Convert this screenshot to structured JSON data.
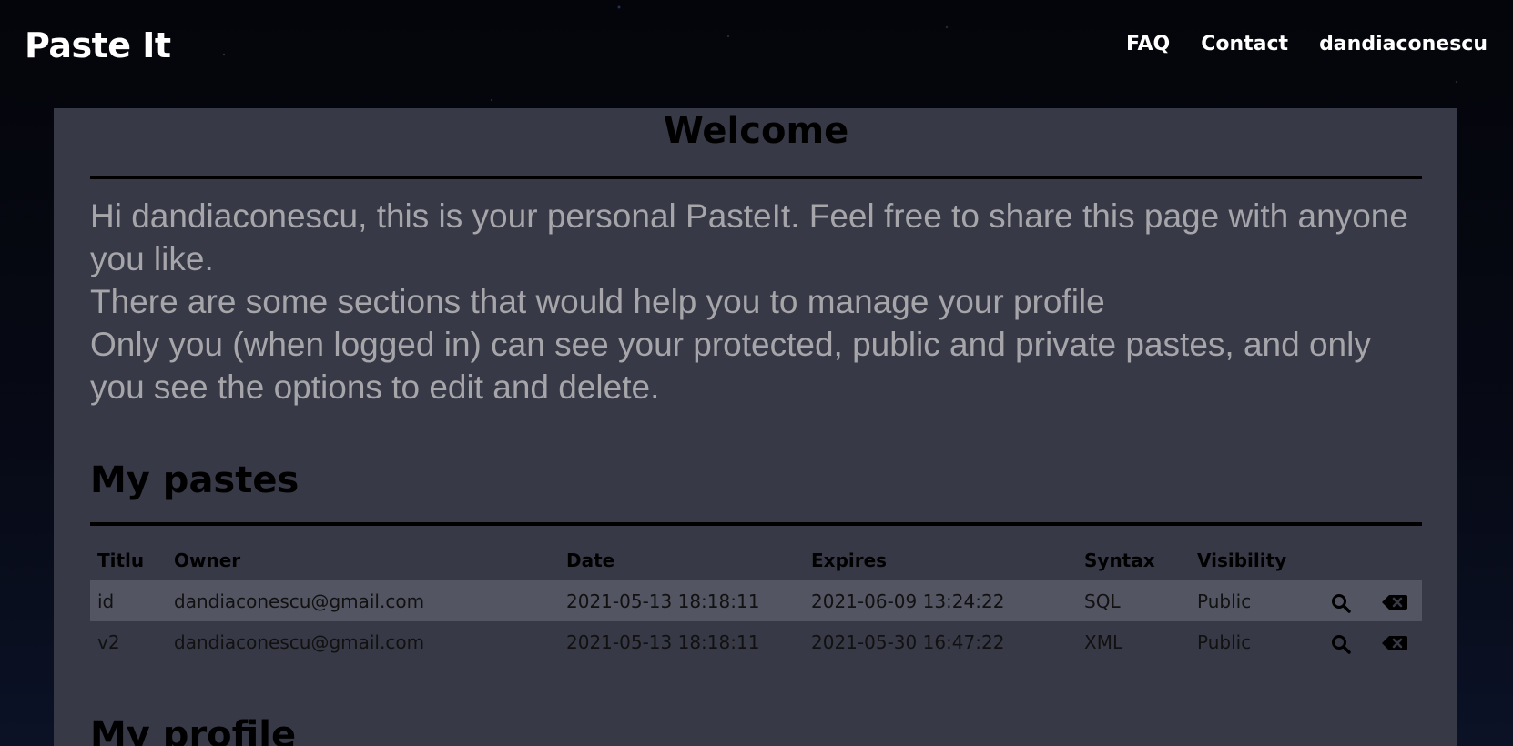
{
  "navbar": {
    "brand": "Paste It",
    "links": [
      "FAQ",
      "Contact",
      "dandiaconescu"
    ]
  },
  "welcome": {
    "title": "Welcome",
    "paragraphs": [
      "Hi dandiaconescu, this is your personal PasteIt. Feel free to share this page with anyone you like.",
      "There are some sections that would help you to manage your profile",
      "Only you (when logged in) can see your protected, public and private pastes, and only you see the options to edit and delete."
    ]
  },
  "pastes": {
    "title": "My pastes",
    "columns": [
      "Titlu",
      "Owner",
      "Date",
      "Expires",
      "Syntax",
      "Visibility"
    ],
    "rows": [
      {
        "title": "id",
        "owner": "dandiaconescu@gmail.com",
        "date": "2021-05-13 18:18:11",
        "expires": "2021-06-09 13:24:22",
        "syntax": "SQL",
        "visibility": "Public",
        "view_icon": "search-icon",
        "delete_icon": "backspace-delete-icon"
      },
      {
        "title": "v2",
        "owner": "dandiaconescu@gmail.com",
        "date": "2021-05-13 18:18:11",
        "expires": "2021-05-30 16:47:22",
        "syntax": "XML",
        "visibility": "Public",
        "view_icon": "search-icon",
        "delete_icon": "backspace-delete-icon"
      }
    ]
  },
  "profile": {
    "title": "My profile"
  }
}
